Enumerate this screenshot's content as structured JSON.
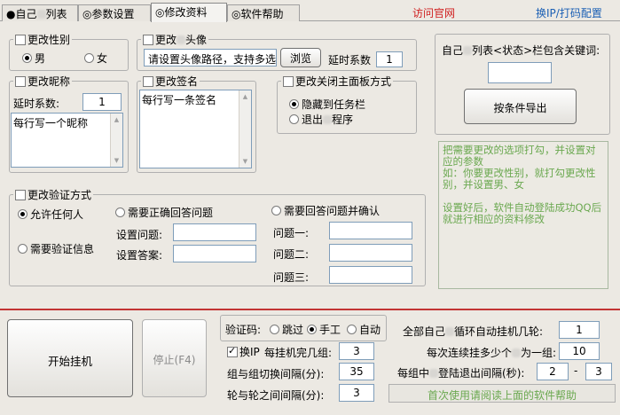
{
  "tabs": [
    {
      "prefix": "●",
      "label_a": "自己",
      "label_b": "列表"
    },
    {
      "prefix": "◎",
      "label": "参数设置"
    },
    {
      "prefix": "◎",
      "label": "修改资料"
    },
    {
      "prefix": "◎",
      "label": "软件帮助"
    }
  ],
  "top_links": {
    "official": "访问官网",
    "switch": "换IP/打码配置"
  },
  "gender": {
    "title": "更改性别",
    "male": "男",
    "female": "女"
  },
  "avatar": {
    "title_a": "更改",
    "title_b": "头像",
    "path_value": "请设置头像路径，支持多选",
    "browse": "浏览",
    "delay_label": "延时系数",
    "delay_value": "1"
  },
  "keyword": {
    "label_a": "自己",
    "label_b": "列表<状态>栏包含关键词:",
    "export": "按条件导出"
  },
  "nickname": {
    "title": "更改昵称",
    "delay_label": "延时系数:",
    "delay_value": "1",
    "text": "每行写一个昵称"
  },
  "signature": {
    "title": "更改签名",
    "text": "每行写一条签名"
  },
  "close_mode": {
    "title": "更改关闭主面板方式",
    "hide": "隐藏到任务栏",
    "exit_a": "退出",
    "exit_b": "程序"
  },
  "hint": {
    "line1": "把需要更改的选项打勾，并设置对应的参数",
    "line2": "如：你要更改性别，就打勾更改性别，并设置男、女",
    "line3": "设置好后，软件自动登陆成功QQ后就进行相应的资料修改"
  },
  "verify": {
    "title": "更改验证方式",
    "allow_all": "允许任何人",
    "need_info": "需要验证信息",
    "need_answer": "需要正确回答问题",
    "set_question": "设置问题:",
    "set_answer": "设置答案:",
    "need_answer_confirm": "需要回答问题并确认",
    "q1": "问题一:",
    "q2": "问题二:",
    "q3": "问题三:"
  },
  "controls": {
    "start": "开始挂机",
    "stop": "停止(F4)",
    "captcha_label": "验证码:",
    "skip": "跳过",
    "manual": "手工",
    "auto": "自动",
    "switch_ip_label": "换IP",
    "per_group_label": "每挂机完几组:",
    "per_group_value": "3",
    "group_interval_label": "组与组切换间隔(分):",
    "group_interval_value": "35",
    "round_interval_label": "轮与轮之间间隔(分):",
    "round_interval_value": "3",
    "loop_label_a": "全部自己",
    "loop_label_b": "循环自动挂机几轮:",
    "loop_value": "1",
    "group_size_label_a": "每次连续挂多少个",
    "group_size_label_b": "为一组:",
    "group_size_value": "10",
    "login_interval_label_a": "每组中",
    "login_interval_label_b": "登陆退出间隔(秒):",
    "login_min": "2",
    "dash": "-",
    "login_max": "3",
    "notice": "首次使用请阅读上面的软件帮助"
  }
}
